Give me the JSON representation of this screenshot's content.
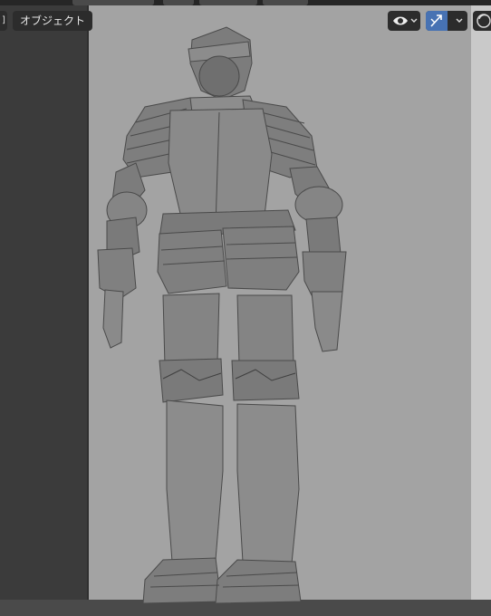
{
  "viewport_header": {
    "mode_label": "オブジェクト",
    "left_stub_label": "]",
    "overlay_icon": "eye-icon",
    "gizmo_icon": "gizmo-arrow-icon",
    "shading_icon": "shading-sphere-icon"
  },
  "scene": {
    "object": "knight-armor-model",
    "viewport_background": "#a3a3a3",
    "active_accent": "#4772b3"
  }
}
